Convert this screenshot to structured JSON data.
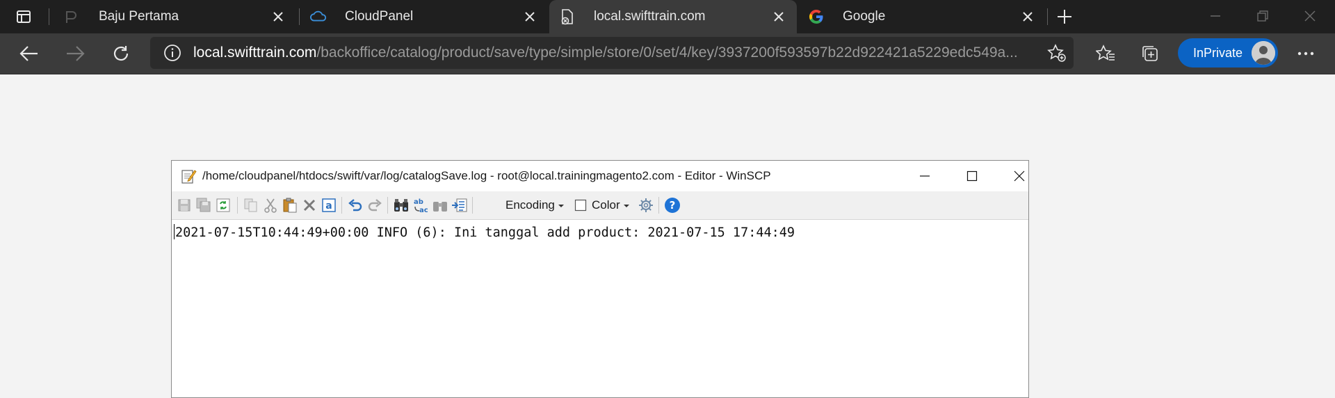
{
  "browser": {
    "tabs": [
      {
        "title": "Baju Pertama",
        "favicon": "page-icon",
        "active": false
      },
      {
        "title": "CloudPanel",
        "favicon": "cloud-icon",
        "active": false
      },
      {
        "title": "local.swifttrain.com",
        "favicon": "document-error-icon",
        "active": true
      },
      {
        "title": "Google",
        "favicon": "google-icon",
        "active": false
      }
    ],
    "address": {
      "host": "local.swifttrain.com",
      "path": "/backoffice/catalog/product/save/type/simple/store/0/set/4/key/3937200f593597b22d922421a5229edc549a..."
    },
    "profile_label": "InPrivate",
    "accent": "#0b63c4"
  },
  "editor": {
    "title": "/home/cloudpanel/htdocs/swift/var/log/catalogSave.log - root@local.trainingmagento2.com - Editor - WinSCP",
    "toolbar": {
      "encoding_label": "Encoding",
      "color_label": "Color"
    },
    "content_lines": [
      "2021-07-15T10:44:49+00:00 INFO (6): Ini tanggal add product: 2021-07-15 17:44:49"
    ]
  }
}
